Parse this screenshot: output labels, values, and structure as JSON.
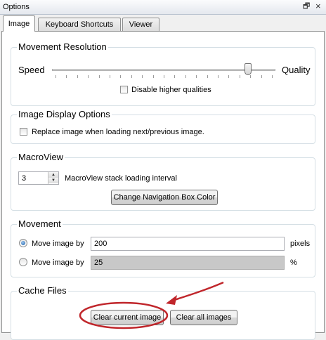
{
  "window": {
    "title": "Options",
    "restore_glyph": "🗗",
    "close_glyph": "×"
  },
  "tabs": [
    {
      "label": "Image",
      "active": true
    },
    {
      "label": "Keyboard Shortcuts",
      "active": false
    },
    {
      "label": "Viewer",
      "active": false
    }
  ],
  "movement_resolution": {
    "title": "Movement Resolution",
    "left_label": "Speed",
    "right_label": "Quality",
    "slider_value": 0.89,
    "disable_higher_label": "Disable higher qualities",
    "disable_higher_checked": false
  },
  "image_display": {
    "title": "Image Display Options",
    "replace_label": "Replace image when loading next/previous image.",
    "replace_checked": false
  },
  "macroview": {
    "title": "MacroView",
    "interval_value": "3",
    "interval_label": "MacroView stack loading interval",
    "nav_color_button": "Change Navigation Box Color"
  },
  "movement": {
    "title": "Movement",
    "option1_label": "Move image by",
    "option1_value": "200",
    "option1_unit": "pixels",
    "option2_label": "Move image by",
    "option2_value": "25",
    "option2_unit": "%",
    "selected": 1
  },
  "cache": {
    "title": "Cache Files",
    "clear_current": "Clear current image",
    "clear_all": "Clear all images"
  },
  "annotation": {
    "highlight_color": "#c0262b"
  }
}
